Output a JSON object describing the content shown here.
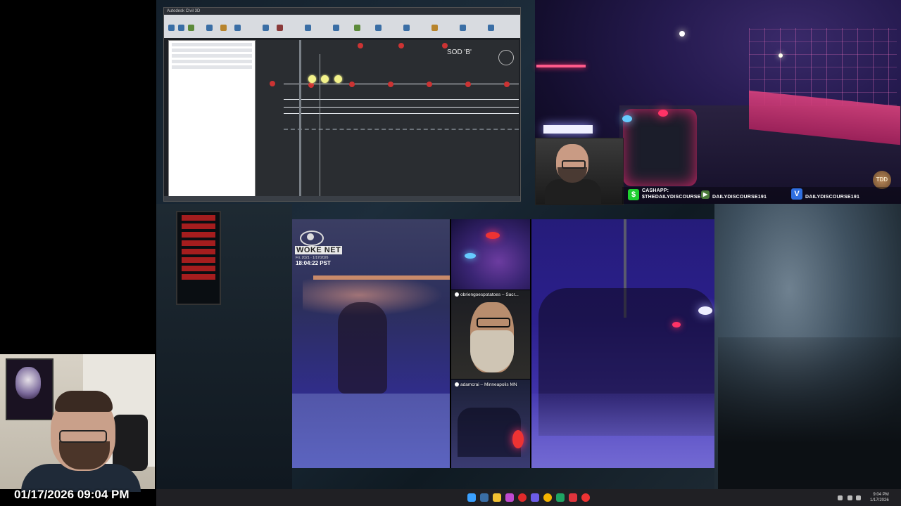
{
  "cad": {
    "window_title": "Autodesk Civil 3D",
    "sod_label": "SOD 'B'"
  },
  "stream_overlay": {
    "cashapp_label": "CASHAPP:",
    "cashapp_handle": "$THEDAILYDISCOURSE",
    "rumble_handle": "DAILYDISCOURSE191",
    "venmo_handle": "DAILYDISCOURSE191",
    "badge_text": "TDD"
  },
  "clips": {
    "woke_net": {
      "logo_text": "WOKE NET",
      "date": "Fri. 2021 · 1/17/2026",
      "time": "18:04:22 PST"
    },
    "tiktok_1": {
      "caption": "obriengoespotatoes – Sacr..."
    },
    "tiktok_2": {
      "caption": "adamcrai – Minneapolis MN"
    }
  },
  "webcam": {
    "timestamp": "01/17/2026 09:04 PM"
  },
  "taskbar": {
    "time": "9:04 PM",
    "date": "1/17/2026"
  },
  "colors": {
    "cashapp_green": "#1fcf2f",
    "venmo_blue": "#2f6fe0",
    "cad_node_red": "#cc3333",
    "cad_select_yellow": "#f3f28a"
  }
}
